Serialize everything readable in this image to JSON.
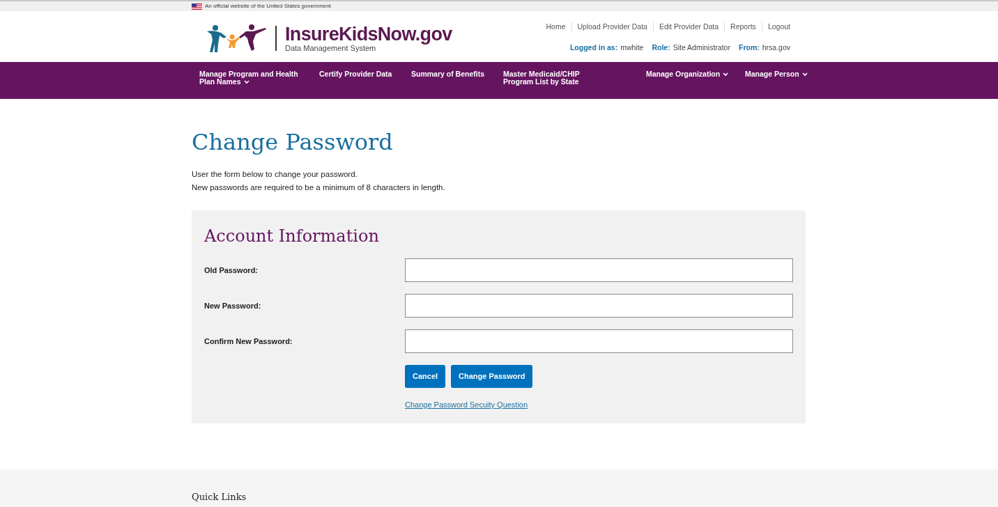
{
  "gov_banner": {
    "text": "An official website of the United States government"
  },
  "logo": {
    "title": "InsureKidsNow.gov",
    "subtitle": "Data Management System"
  },
  "utility_links": [
    "Home",
    "Upload Provider Data",
    "Edit Provider Data",
    "Reports",
    "Logout"
  ],
  "user_info": [
    {
      "label": "Logged in as:",
      "value": "mwhite"
    },
    {
      "label": "Role:",
      "value": "Site Administrator"
    },
    {
      "label": "From:",
      "value": "hrsa.gov"
    }
  ],
  "nav": [
    {
      "label": "Manage Program and Health Plan Names",
      "dropdown": true
    },
    {
      "label": "Certify Provider Data",
      "dropdown": false
    },
    {
      "label": "Summary of Benefits",
      "dropdown": false
    },
    {
      "label": "Master Medicaid/CHIP Program List by State",
      "dropdown": false
    },
    {
      "label": "Manage Organization",
      "dropdown": true
    },
    {
      "label": "Manage Person",
      "dropdown": true
    }
  ],
  "page": {
    "title": "Change Password",
    "intro": [
      "User the form below to change your password.",
      "New passwords are required to be a minimum of 8 characters in length."
    ]
  },
  "form": {
    "title": "Account Information",
    "fields": [
      {
        "label": "Old Password:"
      },
      {
        "label": "New Password:"
      },
      {
        "label": "Confirm New Password:"
      }
    ],
    "buttons": [
      "Cancel",
      "Change Password"
    ],
    "link": "Change Password Secuity Question"
  },
  "footer": {
    "title": "Quick Links"
  }
}
